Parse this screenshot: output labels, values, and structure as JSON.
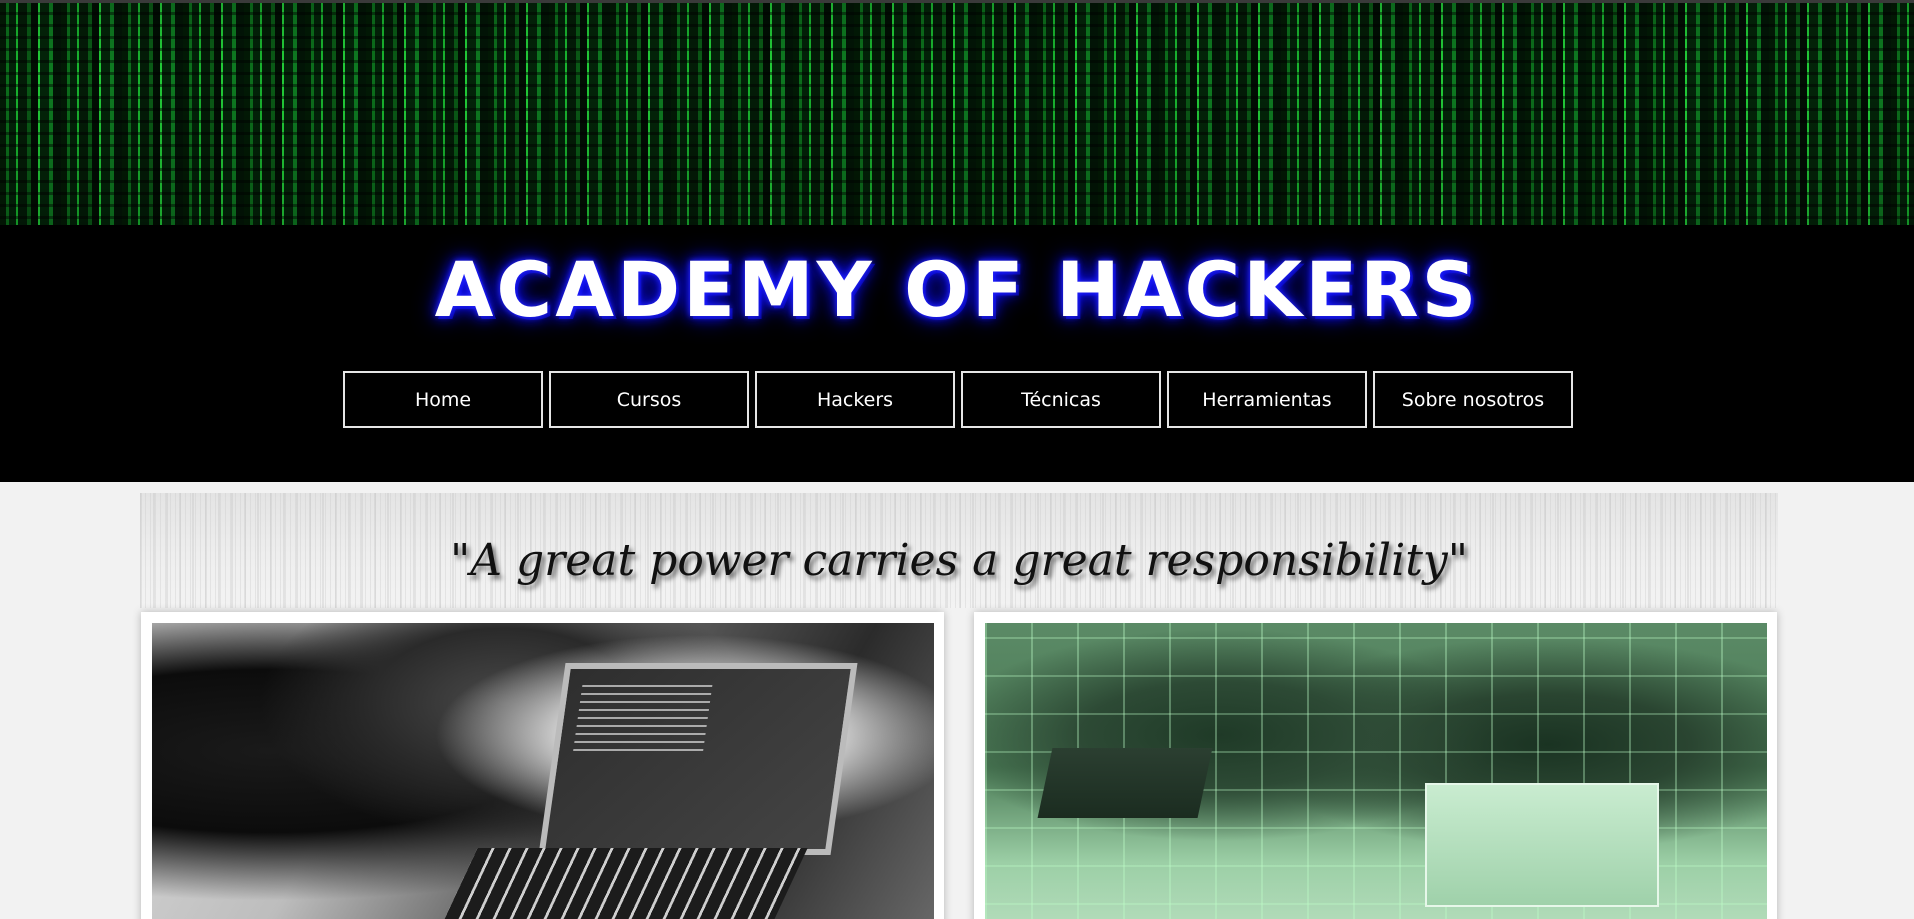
{
  "site": {
    "title": "ACADEMY OF HACKERS"
  },
  "nav": {
    "items": [
      {
        "label": "Home"
      },
      {
        "label": "Cursos"
      },
      {
        "label": "Hackers"
      },
      {
        "label": "Técnicas"
      },
      {
        "label": "Herramientas"
      },
      {
        "label": "Sobre nosotros"
      }
    ]
  },
  "quote": {
    "text": "\"A great power carries a great responsibility\""
  },
  "colors": {
    "header_bg": "#000000",
    "title_glow": "#1010ff",
    "matrix_green": "#19b52f",
    "page_bg": "#f2f2f2"
  }
}
